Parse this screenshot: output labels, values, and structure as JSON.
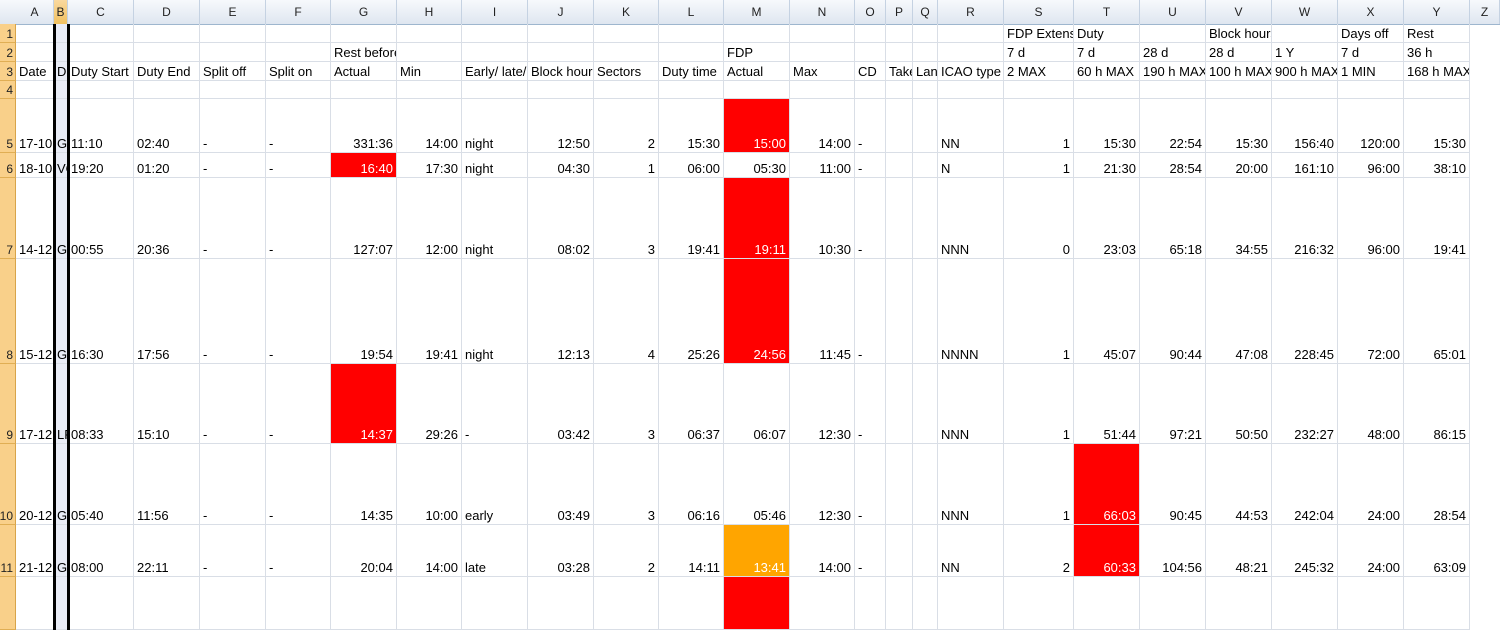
{
  "columns": [
    "A",
    "B",
    "C",
    "D",
    "E",
    "F",
    "G",
    "H",
    "I",
    "J",
    "K",
    "L",
    "M",
    "N",
    "O",
    "P",
    "Q",
    "R",
    "S",
    "T",
    "U",
    "V",
    "W",
    "X",
    "Y",
    "Z"
  ],
  "selected_column": "B",
  "row_numbers": [
    "1",
    "2",
    "3",
    "4",
    "5",
    "6",
    "7",
    "8",
    "9",
    "10",
    "11"
  ],
  "header": {
    "row1": {
      "S": "FDP Extensi",
      "T": "Duty",
      "V": "Block hours",
      "X": "Days off",
      "Y": "Rest"
    },
    "row2": {
      "G": "Rest before duty",
      "M": "FDP",
      "S": "7 d",
      "T": "7 d",
      "U": "28 d",
      "V": "28 d",
      "W": "1 Y",
      "X": "7 d",
      "Y": "36 h"
    },
    "row3": {
      "A": "Date",
      "B": "Du",
      "C": "Duty Start",
      "D": "Duty End",
      "E": "Split off",
      "F": "Split on",
      "G": "Actual",
      "H": "Min",
      "I": "Early/ late/",
      "J": "Block hour",
      "K": "Sectors",
      "L": "Duty time",
      "M": "Actual",
      "N": "Max",
      "O": "CD",
      "P": "Take",
      "Q": "Lan",
      "R": "ICAO type",
      "S": "2 MAX",
      "T": "60 h MAX",
      "U": "190 h MAX",
      "V": "100 h MAX",
      "W": "900 h MAX",
      "X": "1 MIN",
      "Y": "168 h MAX"
    }
  },
  "rows": [
    {
      "A": "17-10",
      "B": "GN",
      "C": "11:10",
      "D": "02:40",
      "E": "-",
      "F": "-",
      "G": "331:36",
      "H": "14:00",
      "I": "night",
      "J": "12:50",
      "K": "2",
      "L": "15:30",
      "M": "15:00",
      "N": "14:00",
      "O": "-",
      "R": "NN",
      "S": "1",
      "T": "15:30",
      "U": "22:54",
      "V": "15:30",
      "W": "156:40",
      "X": "120:00",
      "Y": "15:30"
    },
    {
      "A": "18-10",
      "B": "VO",
      "C": "19:20",
      "D": "01:20",
      "E": "-",
      "F": "-",
      "G": "16:40",
      "H": "17:30",
      "I": "night",
      "J": "04:30",
      "K": "1",
      "L": "06:00",
      "M": "05:30",
      "N": "11:00",
      "O": "-",
      "R": "N",
      "S": "1",
      "T": "21:30",
      "U": "28:54",
      "V": "20:00",
      "W": "161:10",
      "X": "96:00",
      "Y": "38:10"
    },
    {
      "A": "14-12",
      "B": "GN",
      "C": "00:55",
      "D": "20:36",
      "E": "-",
      "F": "-",
      "G": "127:07",
      "H": "12:00",
      "I": "night",
      "J": "08:02",
      "K": "3",
      "L": "19:41",
      "M": "19:11",
      "N": "10:30",
      "O": "-",
      "R": "NNN",
      "S": "0",
      "T": "23:03",
      "U": "65:18",
      "V": "34:55",
      "W": "216:32",
      "X": "96:00",
      "Y": "19:41"
    },
    {
      "A": "15-12",
      "B": "GU",
      "C": "16:30",
      "D": "17:56",
      "E": "-",
      "F": "-",
      "G": "19:54",
      "H": "19:41",
      "I": "night",
      "J": "12:13",
      "K": "4",
      "L": "25:26",
      "M": "24:56",
      "N": "11:45",
      "O": "-",
      "R": "NNNN",
      "S": "1",
      "T": "45:07",
      "U": "90:44",
      "V": "47:08",
      "W": "228:45",
      "X": "72:00",
      "Y": "65:01"
    },
    {
      "A": "17-12",
      "B": "LF",
      "C": "08:33",
      "D": "15:10",
      "E": "-",
      "F": "-",
      "G": "14:37",
      "H": "29:26",
      "I": "-",
      "J": "03:42",
      "K": "3",
      "L": "06:37",
      "M": "06:07",
      "N": "12:30",
      "O": "-",
      "R": "NNN",
      "S": "1",
      "T": "51:44",
      "U": "97:21",
      "V": "50:50",
      "W": "232:27",
      "X": "48:00",
      "Y": "86:15"
    },
    {
      "A": "20-12",
      "B": "GN",
      "C": "05:40",
      "D": "11:56",
      "E": "-",
      "F": "-",
      "G": "14:35",
      "H": "10:00",
      "I": "early",
      "J": "03:49",
      "K": "3",
      "L": "06:16",
      "M": "05:46",
      "N": "12:30",
      "O": "-",
      "R": "NNN",
      "S": "1",
      "T": "66:03",
      "U": "90:45",
      "V": "44:53",
      "W": "242:04",
      "X": "24:00",
      "Y": "28:54"
    },
    {
      "A": "21-12",
      "B": "GN",
      "C": "08:00",
      "D": "22:11",
      "E": "-",
      "F": "-",
      "G": "20:04",
      "H": "14:00",
      "I": "late",
      "J": "03:28",
      "K": "2",
      "L": "14:11",
      "M": "13:41",
      "N": "14:00",
      "O": "-",
      "R": "NN",
      "S": "2",
      "T": "60:33",
      "U": "104:56",
      "V": "48:21",
      "W": "245:32",
      "X": "24:00",
      "Y": "63:09"
    }
  ],
  "highlight_colors": {
    "violation": "#ff0000",
    "warning": "#ffa500",
    "selected_header": "#f1c15f",
    "row_header": "#f9d08a"
  }
}
